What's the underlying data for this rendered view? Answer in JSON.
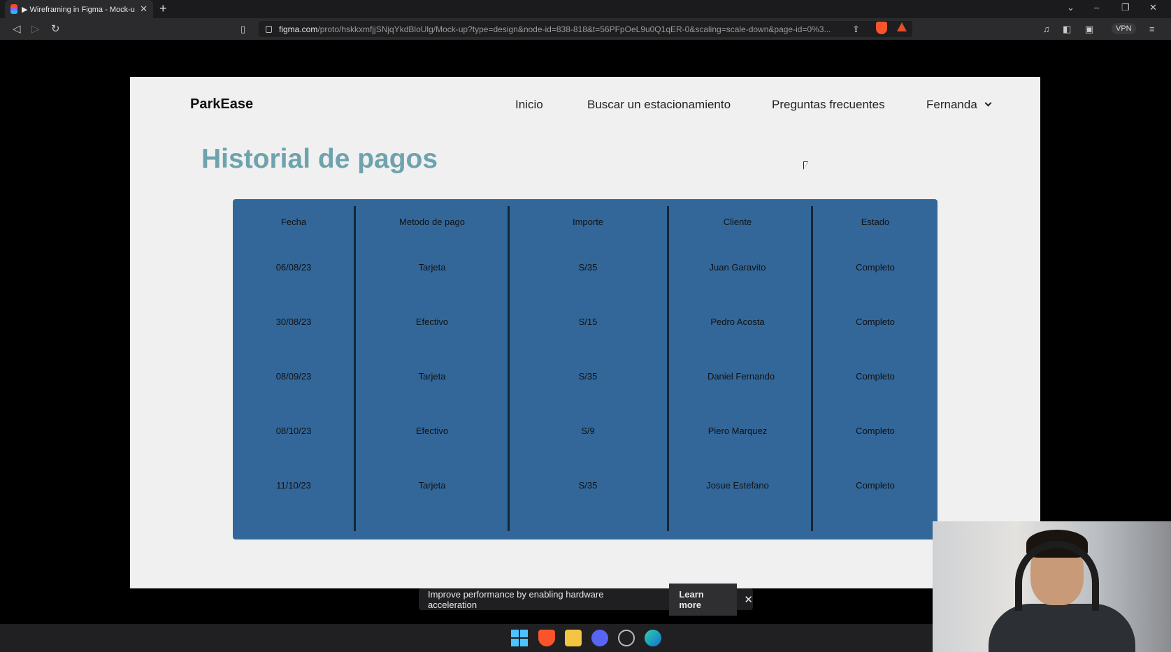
{
  "browser": {
    "tab_title": "▶ Wireframing in Figma - Mock-u",
    "tab_close": "✕",
    "new_tab": "+",
    "url_domain": "figma.com",
    "url_path": "/proto/hskkxmfjjSNjqYkdBloUlg/Mock-up?type=design&node-id=838-818&t=56PFpOeL9u0Q1qER-0&scaling=scale-down&page-id=0%3...",
    "vpn_label": "VPN",
    "icons": [
      "back-icon",
      "forward-icon",
      "reload-icon",
      "bookmark-icon",
      "lock-icon",
      "share-icon",
      "brave-shield-icon",
      "brave-rewards-icon",
      "media-icon",
      "sidebar-icon",
      "wallet-icon",
      "menu-icon"
    ]
  },
  "site": {
    "logo": "ParkEase",
    "nav": {
      "inicio": "Inicio",
      "buscar": "Buscar un estacionamiento",
      "preguntas": "Preguntas frecuentes",
      "user": "Fernanda"
    },
    "page_title": "Historial de pagos"
  },
  "table": {
    "headers": [
      "Fecha",
      "Metodo de pago",
      "Importe",
      "Cliente",
      "Estado"
    ],
    "rows": [
      [
        "06/08/23",
        "Tarjeta",
        "S/35",
        "Juan Garavito",
        "Completo"
      ],
      [
        "30/08/23",
        "Efectivo",
        "S/15",
        "Pedro Acosta",
        "Completo"
      ],
      [
        "08/09/23",
        "Tarjeta",
        "S/35",
        "Daniel Fernando",
        "Completo"
      ],
      [
        "08/10/23",
        "Efectivo",
        "S/9",
        "Piero Marquez",
        "Completo"
      ],
      [
        "11/10/23",
        "Tarjeta",
        "S/35",
        "Josue Estefano",
        "Completo"
      ]
    ]
  },
  "toast": {
    "message": "Improve performance by enabling hardware acceleration",
    "learn_more": "Learn more",
    "close": "✕"
  },
  "colors": {
    "title_teal": "#6ea3ad",
    "table_blue": "#336799",
    "divider_navy": "#132538",
    "canvas_bg": "#f0f0f0"
  }
}
